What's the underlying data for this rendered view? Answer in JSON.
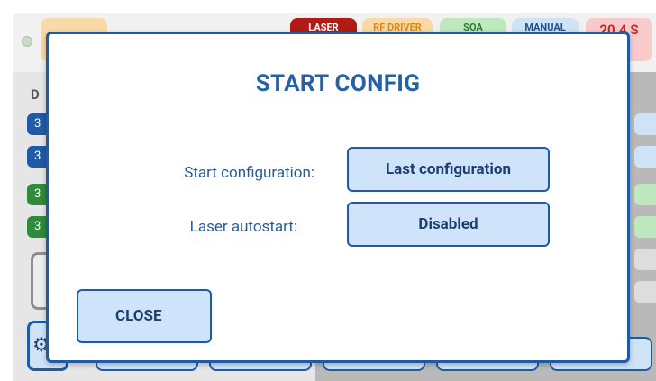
{
  "modal": {
    "title": "START CONFIG",
    "start_config_label": "Start configuration:",
    "start_config_value": "Last configuration",
    "laser_autostart_label": "Laser autostart:",
    "laser_autostart_value": "Disabled",
    "close_label": "CLOSE"
  },
  "background": {
    "status_badges": [
      "LASER",
      "RF DRIVER",
      "SOA",
      "MANUAL",
      "20.4 S"
    ],
    "left_label": "D",
    "channel_chip_text": "3"
  },
  "colors": {
    "accent": "#1f5aa6",
    "title": "#2661a8",
    "button_fill": "#cfe3fb",
    "laser_badge": "#b01b16"
  }
}
